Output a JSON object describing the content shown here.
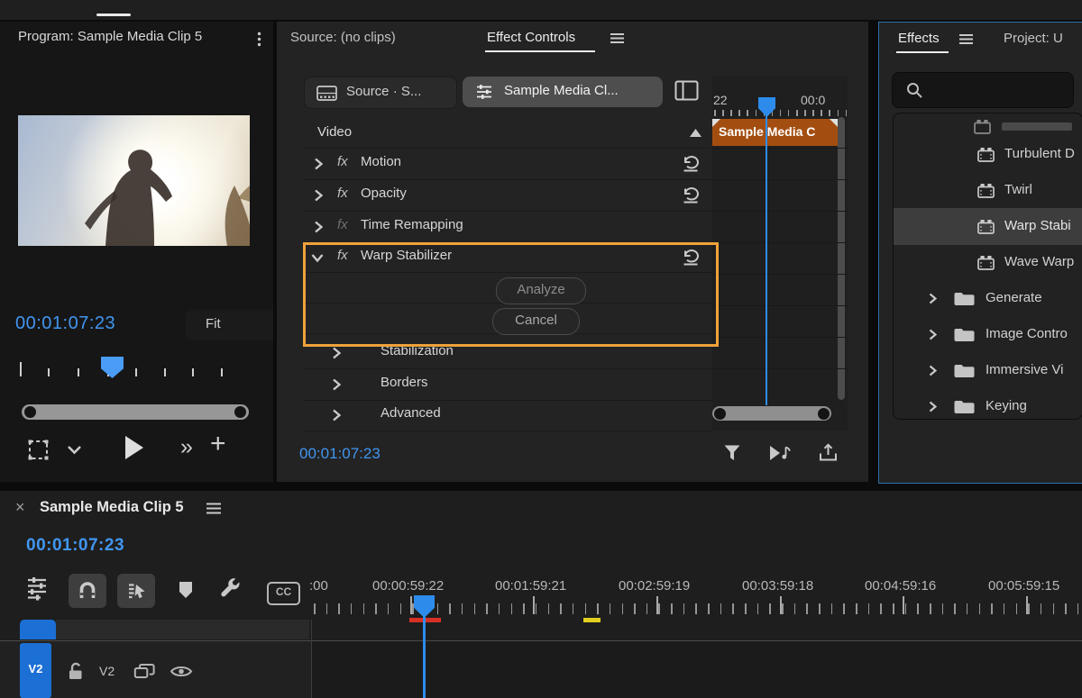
{
  "glyphs": {
    "close": "×",
    "double_chevron": "»",
    "plus": "+",
    "fx": "fx"
  },
  "program": {
    "title": "Program: Sample Media Clip 5",
    "timecode": "00:01:07:23",
    "fit": "Fit"
  },
  "effect_controls": {
    "tab_source": "Source: (no clips)",
    "tab_effect_controls": "Effect Controls",
    "source_button": "Source · S...",
    "clip_button": "Sample Media Cl...",
    "section_video": "Video",
    "row_motion": "Motion",
    "row_opacity": "Opacity",
    "row_time_remapping": "Time Remapping",
    "row_warp": "Warp Stabilizer",
    "analyze": "Analyze",
    "cancel": "Cancel",
    "group_stabilization": "Stabilization",
    "group_borders": "Borders",
    "group_advanced": "Advanced",
    "timecode": "00:01:07:23",
    "ruler_label_1": "22",
    "ruler_label_2": "00:0",
    "clip_label": "Sample Media C"
  },
  "effects_panel": {
    "tab_effects": "Effects",
    "tab_project": "Project: U",
    "item_turbulent": "Turbulent D",
    "item_twirl": "Twirl",
    "item_warp": "Warp Stabi",
    "item_wave": "Wave Warp",
    "folder_generate": "Generate",
    "folder_image": "Image Contro",
    "folder_immersive": "Immersive Vi",
    "folder_keying": "Keying"
  },
  "timeline": {
    "tab": "Sample Media Clip 5",
    "timecode": "00:01:07:23",
    "cc": "CC",
    "ruler": [
      ":00",
      "00:00:59:22",
      "00:01:59:21",
      "00:02:59:19",
      "00:03:59:18",
      "00:04:59:16",
      "00:05:59:15"
    ],
    "track_badge": "V2",
    "track_label": "V2"
  },
  "colors": {
    "accent_blue": "#2d8ceb",
    "timecode_blue": "#4196f0",
    "highlight_orange": "#f0a23b",
    "clip_orange": "#a34e10",
    "track_badge_blue": "#1c6fd4",
    "marker_red": "#d93025",
    "marker_yellow": "#e3cf1f",
    "panel_focus_border": "#2e6ea6"
  }
}
